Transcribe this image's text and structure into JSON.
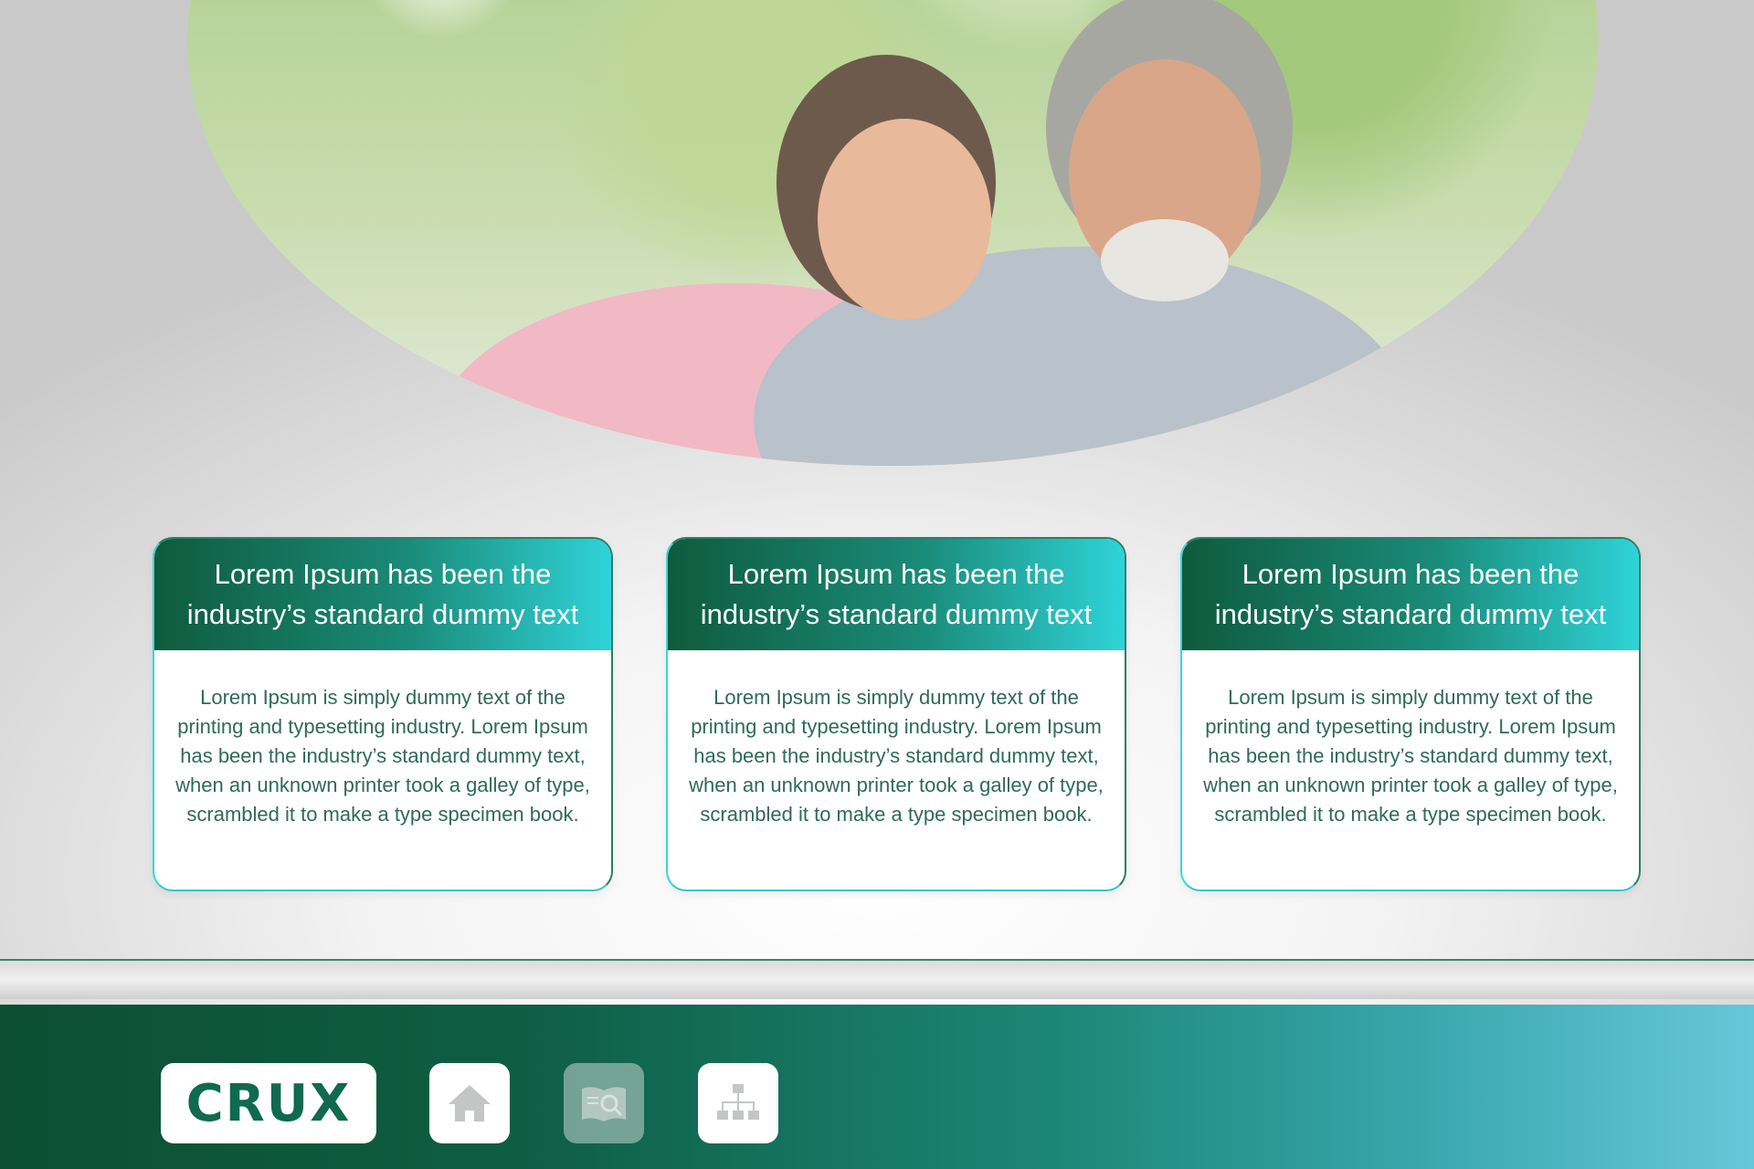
{
  "hero": {
    "icon": "photo-couple"
  },
  "cards": [
    {
      "title": "Lorem Ipsum has been the industry’s standard dummy text",
      "body": "Lorem Ipsum is simply dummy text of the printing and typesetting industry. Lorem Ipsum has been the industry’s standard dummy text, when an unknown printer took a galley of type, scrambled it to make a type specimen book."
    },
    {
      "title": "Lorem Ipsum has been the industry’s standard dummy text",
      "body": "Lorem Ipsum is simply dummy text of the printing and typesetting industry. Lorem Ipsum has been the industry’s standard dummy text, when an unknown printer took a galley of type, scrambled it to make a type specimen book."
    },
    {
      "title": "Lorem Ipsum has been the industry’s standard dummy text",
      "body": "Lorem Ipsum is simply dummy text of the printing and typesetting industry. Lorem Ipsum has been the industry’s standard dummy text, when an unknown printer took a galley of type, scrambled it to make a type specimen book."
    }
  ],
  "footer": {
    "logo": "CRUX",
    "buttons": [
      {
        "icon": "home-icon",
        "active": true
      },
      {
        "icon": "book-search-icon",
        "active": false
      },
      {
        "icon": "sitemap-icon",
        "active": true
      }
    ]
  },
  "colors": {
    "brand_dark": "#0c4f33",
    "brand_teal": "#2fd3d8",
    "logo_green": "#0f6a4e"
  }
}
